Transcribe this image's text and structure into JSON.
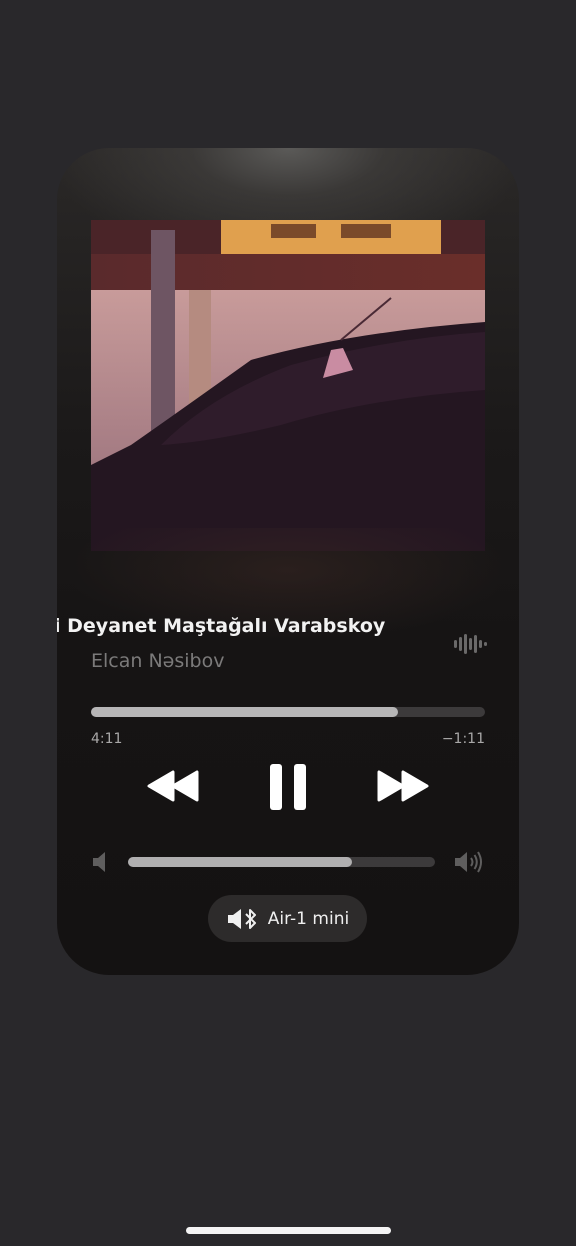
{
  "player": {
    "title": "ıli Deyanet Maştağalı Varabskoy",
    "artist": "Elcan Nəsibov",
    "progress_fraction": 0.78,
    "time_elapsed": "4:11",
    "time_remaining": "−1:11",
    "volume_fraction": 0.73,
    "output_device": "Air-1 mini"
  },
  "icons": {
    "waveform": "waveform-icon",
    "rewind": "rewind-icon",
    "pause": "pause-icon",
    "fast_forward": "fast-forward-icon",
    "volume_low": "speaker-low-icon",
    "volume_high": "speaker-high-icon",
    "output": "speaker-bluetooth-icon"
  },
  "colors": {
    "background": "#29282b",
    "accent_text": "#f2f2f2",
    "secondary_text": "#7b7a7a"
  }
}
